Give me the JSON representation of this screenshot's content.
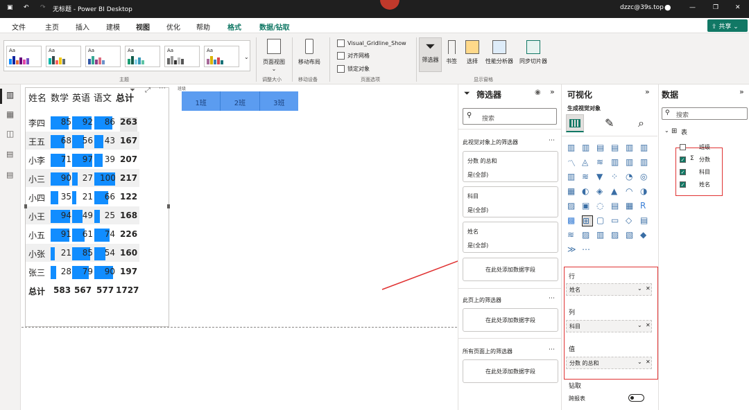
{
  "app": {
    "title": "无标题 - Power BI Desktop",
    "user": "dzzc@39s.top"
  },
  "menu": [
    "文件",
    "主页",
    "插入",
    "建模",
    "视图",
    "优化",
    "帮助",
    "格式",
    "数据/钻取"
  ],
  "share_label": "共享",
  "ribbon": {
    "themes_group": "主题",
    "page_view": "页面视图",
    "resize_group": "调整大小",
    "mobile_layout": "移动布局",
    "mobile_group": "移动设备",
    "options": [
      "Visual_Gridline_Show",
      "对齐网格",
      "锁定对象"
    ],
    "page_options_group": "页面选项",
    "panes": [
      "筛选器",
      "书签",
      "选择",
      "性能分析器",
      "同步切片器"
    ],
    "show_panes_group": "显示窗格"
  },
  "slicer": {
    "label": "班级",
    "buttons": [
      "1班",
      "2班",
      "3班"
    ]
  },
  "table": {
    "headers": [
      "姓名",
      "数学",
      "英语",
      "语文",
      "总计"
    ],
    "rows": [
      {
        "name": "李四",
        "math": 85,
        "english": 92,
        "chinese": 86,
        "total": 263
      },
      {
        "name": "王五",
        "math": 68,
        "english": 56,
        "chinese": 43,
        "total": 167
      },
      {
        "name": "小李",
        "math": 71,
        "english": 97,
        "chinese": 39,
        "total": 207
      },
      {
        "name": "小三",
        "math": 90,
        "english": 27,
        "chinese": 100,
        "total": 217
      },
      {
        "name": "小四",
        "math": 35,
        "english": 21,
        "chinese": 66,
        "total": 122
      },
      {
        "name": "小王",
        "math": 94,
        "english": 49,
        "chinese": 25,
        "total": 168
      },
      {
        "name": "小五",
        "math": 91,
        "english": 61,
        "chinese": 74,
        "total": 226
      },
      {
        "name": "小张",
        "math": 21,
        "english": 85,
        "chinese": 54,
        "total": 160
      },
      {
        "name": "张三",
        "math": 28,
        "english": 79,
        "chinese": 90,
        "total": 197
      }
    ],
    "total_row": {
      "name": "总计",
      "math": 583,
      "english": 567,
      "chinese": 577,
      "total": 1727
    },
    "bar_max": 100
  },
  "filters": {
    "title": "筛选器",
    "search_placeholder": "搜索",
    "visual_section": "此视觉对象上的筛选器",
    "cards": [
      {
        "field": "分数 的总和",
        "value": "是(全部)"
      },
      {
        "field": "科目",
        "value": "是(全部)"
      },
      {
        "field": "姓名",
        "value": "是(全部)"
      }
    ],
    "add_field": "在此处添加数据字段",
    "page_section": "此页上的筛选器",
    "all_pages_section": "所有页面上的筛选器"
  },
  "viz": {
    "title": "可视化",
    "build_label": "生成视觉对象",
    "rows_label": "行",
    "rows_field": "姓名",
    "cols_label": "列",
    "cols_field": "科目",
    "values_label": "值",
    "values_field": "分数 的总和",
    "drill_label": "钻取",
    "cross_report": "跨报表"
  },
  "data": {
    "title": "数据",
    "search_placeholder": "搜索",
    "table_name": "表",
    "fields": [
      {
        "name": "班级",
        "checked": false,
        "sigma": false
      },
      {
        "name": "分数",
        "checked": true,
        "sigma": true
      },
      {
        "name": "科目",
        "checked": true,
        "sigma": false
      },
      {
        "name": "姓名",
        "checked": true,
        "sigma": false
      }
    ]
  },
  "colors": {
    "accent": "#118dff",
    "annotation": "#e03131",
    "green": "#117865"
  }
}
